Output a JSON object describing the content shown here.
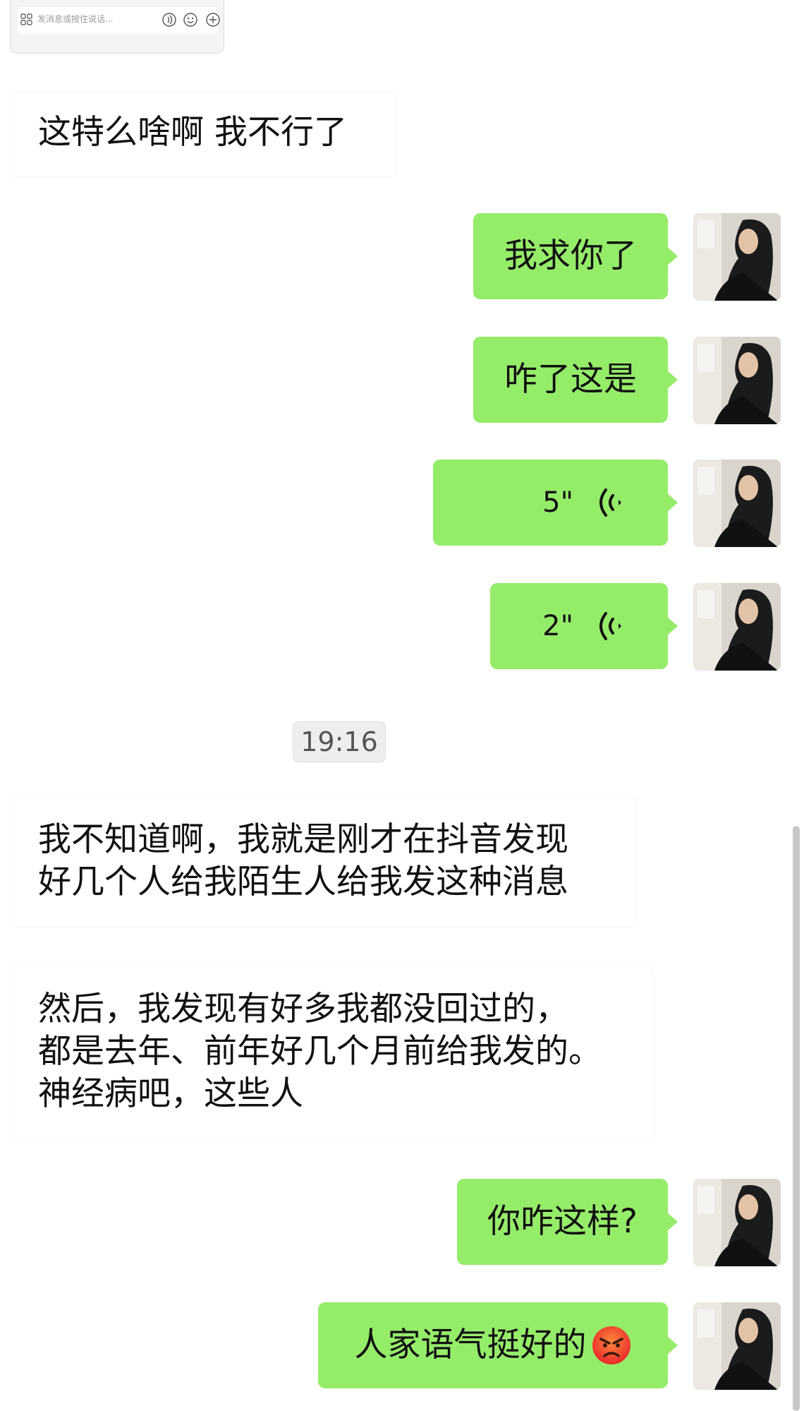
{
  "input_bar": {
    "placeholder": "发消息或按住说话...",
    "icons": [
      "apps-grid-icon",
      "voice-icon",
      "emoji-icon",
      "plus-icon"
    ]
  },
  "messages": [
    {
      "side": "in",
      "text": "这特么啥啊 我不行了"
    },
    {
      "side": "out",
      "text": "我求你了"
    },
    {
      "side": "out",
      "text": "咋了这是"
    },
    {
      "side": "out",
      "type": "voice",
      "duration": "5\""
    },
    {
      "side": "out",
      "type": "voice",
      "duration": "2\""
    },
    {
      "side": "in",
      "lines": [
        "我不知道啊，我就是刚才在抖音发现",
        "好几个人给我陌生人给我发这种消息"
      ]
    },
    {
      "side": "in",
      "lines": [
        "然后，我发现有好多我都没回过的，",
        "都是去年、前年好几个月前给我发的。",
        "神经病吧，这些人"
      ]
    },
    {
      "side": "out",
      "text": "你咋这样?"
    },
    {
      "side": "out",
      "text": "人家语气挺好的",
      "emoji": "angry-face-emoji"
    }
  ],
  "timestamp": "19:16",
  "colors": {
    "outgoing_bubble": "#95ec69",
    "incoming_bubble": "#ffffff",
    "background": "#ffffff"
  }
}
